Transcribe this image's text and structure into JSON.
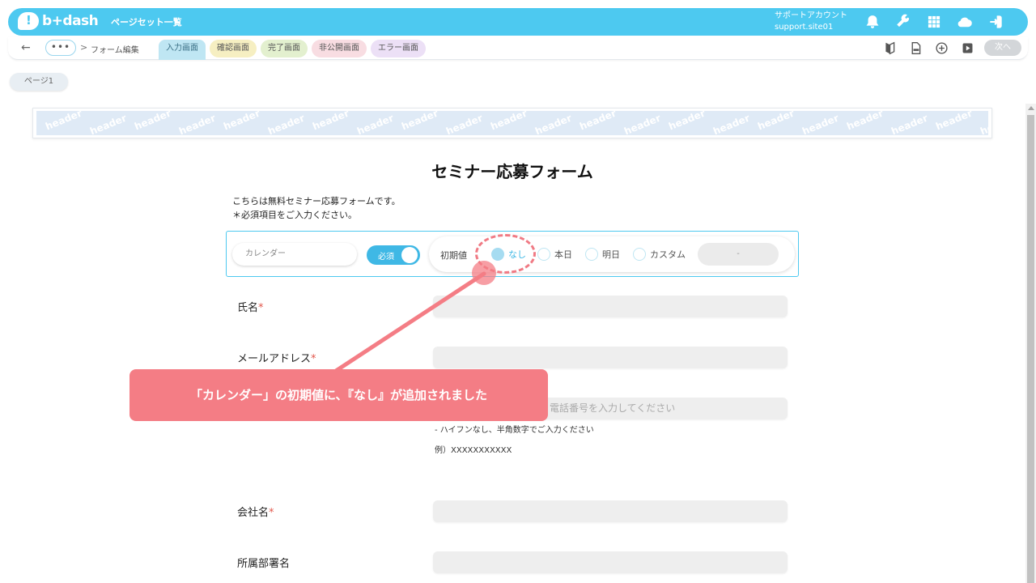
{
  "appbar": {
    "logo_text": "b+dash",
    "title": "ページセット一覧",
    "account_line1": "サポートアカウント",
    "account_line2": "support.site01",
    "icons": [
      "bell-icon",
      "wrench-icon",
      "apps-grid-icon",
      "cloud-chat-icon",
      "logout-icon"
    ]
  },
  "toolbar": {
    "back": "←",
    "more": "•••",
    "separator": ">",
    "breadcrumb": "フォーム編集",
    "tabs": [
      "入力画面",
      "確認画面",
      "完了画面",
      "非公開画面",
      "エラー画面"
    ],
    "tool_icons": [
      "beginner-mark-icon",
      "html-file-icon",
      "add-circle-icon",
      "play-icon"
    ],
    "next_label": "次へ"
  },
  "page_tab": "ページ1",
  "header_banner": "header",
  "form": {
    "title": "セミナー応募フォーム",
    "intro_line1": "こちらは無料セミナー応募フォームです。",
    "intro_line2": "＊必須項目をご入力ください。",
    "calendar": {
      "name_placeholder": "カレンダー",
      "required_label": "必須",
      "initial_label": "初期値",
      "options": [
        "なし",
        "本日",
        "明日",
        "カスタム"
      ],
      "selected": "なし",
      "custom_value": "-"
    },
    "fields": {
      "name_label": "氏名",
      "email_label": "メールアドレス",
      "phone_placeholder": "電話番号を入力してください",
      "phone_hint1": "- ハイフンなし、半角数字でご入力ください",
      "phone_hint2": "例）XXXXXXXXXXX",
      "company_label": "会社名",
      "department_label": "所属部署名",
      "required_mark": "*"
    }
  },
  "annotation": {
    "text": "「カレンダー」の初期値に、『なし』が追加されました",
    "color": "#f47d85"
  },
  "colors": {
    "brand": "#4dc9f0",
    "toggle": "#3fb8e5",
    "required": "#e2574c"
  }
}
